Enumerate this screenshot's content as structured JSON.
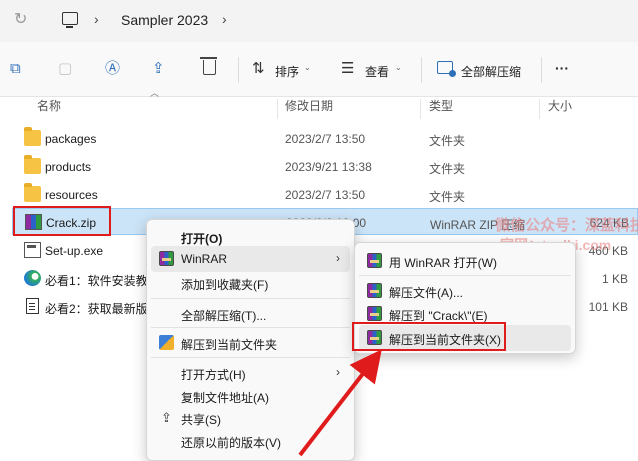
{
  "address": {
    "location": "Sampler 2023"
  },
  "toolbar": {
    "sort_label": "排序",
    "view_label": "查看",
    "extract_all_label": "全部解压缩",
    "more_label": "···"
  },
  "columns": {
    "name": "名称",
    "date": "修改日期",
    "type": "类型",
    "size": "大小"
  },
  "files": [
    {
      "name": "packages",
      "date": "2023/2/7 13:50",
      "type": "文件夹",
      "size": "",
      "icon": "folder-icon"
    },
    {
      "name": "products",
      "date": "2023/9/21 13:38",
      "type": "文件夹",
      "size": "",
      "icon": "folder-icon"
    },
    {
      "name": "resources",
      "date": "2023/2/7 13:50",
      "type": "文件夹",
      "size": "",
      "icon": "folder-icon"
    },
    {
      "name": "Crack.zip",
      "date": "2023/9/2 13:00",
      "type": "WinRAR ZIP 压缩",
      "size": "624 KB",
      "icon": "winrar-zip-icon"
    },
    {
      "name": "Set-up.exe",
      "date": "",
      "type": "",
      "size": "460 KB",
      "icon": "exe-icon"
    },
    {
      "name": "必看1：软件安装教",
      "date": "",
      "type": "",
      "size": "1 KB",
      "icon": "edge-icon"
    },
    {
      "name": "必看2：获取最新版",
      "date": "",
      "type": "",
      "size": "101 KB",
      "icon": "document-icon"
    }
  ],
  "context_menu": {
    "items": [
      {
        "label": "打开(O)",
        "bold": true
      },
      {
        "label": "WinRAR",
        "submenu": true,
        "icon": "winrar-icon"
      },
      {
        "label": "添加到收藏夹(F)"
      },
      {
        "label": "全部解压缩(T)..."
      },
      {
        "label": "解压到当前文件夹",
        "icon": "extract-icon"
      },
      {
        "label": "打开方式(H)",
        "submenu": true
      },
      {
        "label": "复制文件地址(A)"
      },
      {
        "label": "共享(S)",
        "icon": "share-icon"
      },
      {
        "label": "还原以前的版本(V)"
      }
    ]
  },
  "winrar_submenu": {
    "items": [
      {
        "label": "用 WinRAR 打开(W)"
      },
      {
        "label": "解压文件(A)..."
      },
      {
        "label": "解压到 \"Crack\\\"(E)"
      },
      {
        "label": "解压到当前文件夹(X)"
      }
    ]
  },
  "watermark": {
    "line1": "微信公众号：深蓝科技",
    "line2": "官网：tanlki.com"
  },
  "colors": {
    "highlight": "#e01b1b",
    "selection": "#cce4f7",
    "accent": "#2d6fb8"
  }
}
